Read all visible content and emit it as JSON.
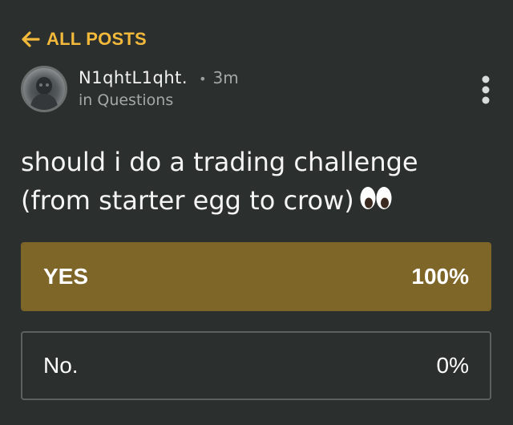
{
  "nav": {
    "back_label": "ALL POSTS",
    "back_icon": "arrow-left-icon",
    "accent_color": "#f2b93b"
  },
  "post": {
    "author": "N1qhtL1qht.",
    "time_ago": "3m",
    "category": "in Questions",
    "menu_icon": "more-vertical-icon",
    "question": "should i do a trading challenge (from starter egg to crow)",
    "question_emoji": "eyes-emoji"
  },
  "poll": {
    "options": [
      {
        "label": "YES",
        "percent_label": "100%",
        "fraction": 1.0,
        "selected": true
      },
      {
        "label": "No.",
        "percent_label": "0%",
        "fraction": 0.0,
        "selected": false
      }
    ],
    "fill_color": "#7e6629"
  }
}
